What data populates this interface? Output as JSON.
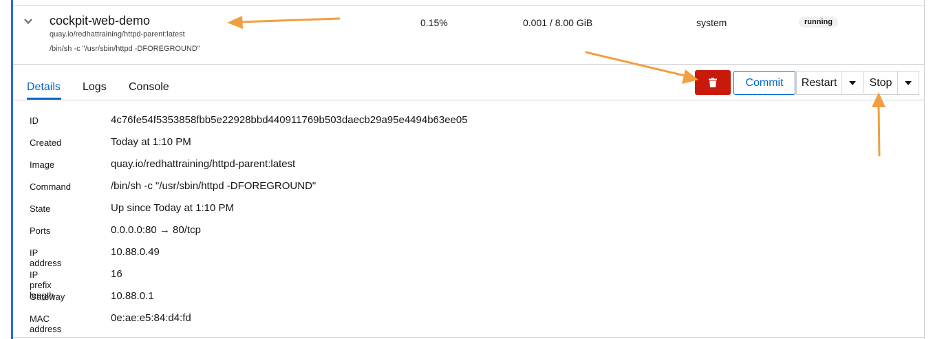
{
  "container": {
    "name": "cockpit-web-demo",
    "image": "quay.io/redhattraining/httpd-parent:latest",
    "command": "/bin/sh -c \"/usr/sbin/httpd -DFOREGROUND\"",
    "cpu": "0.15%",
    "memory": "0.001 / 8.00 GiB",
    "owner": "system",
    "state": "running"
  },
  "tabs": [
    {
      "label": "Details",
      "active": true
    },
    {
      "label": "Logs",
      "active": false
    },
    {
      "label": "Console",
      "active": false
    }
  ],
  "actions": {
    "delete_icon": "trash-icon",
    "commit_label": "Commit",
    "restart_label": "Restart",
    "stop_label": "Stop"
  },
  "details": [
    {
      "key": "ID",
      "value": "4c76fe54f5353858fbb5e22928bbd440911769b503daecb29a95e4494b63ee05"
    },
    {
      "key": "Created",
      "value": "Today at 1:10 PM"
    },
    {
      "key": "Image",
      "value": "quay.io/redhattraining/httpd-parent:latest"
    },
    {
      "key": "Command",
      "value": "/bin/sh -c \"/usr/sbin/httpd -DFOREGROUND\""
    },
    {
      "key": "State",
      "value": "Up since Today at 1:10 PM"
    },
    {
      "key": "Ports",
      "value": "0.0.0.0:80 → 80/tcp"
    },
    {
      "key": "IP address",
      "value": "10.88.0.49"
    },
    {
      "key": "IP prefix length",
      "value": "16"
    },
    {
      "key": "Gateway",
      "value": "10.88.0.1"
    },
    {
      "key": "MAC address",
      "value": "0e:ae:e5:84:d4:fd"
    }
  ],
  "colors": {
    "accent": "#0066cc",
    "danger": "#c9190b",
    "annotation_arrow": "#f0a040",
    "panel_border": "#2b6ec9"
  }
}
